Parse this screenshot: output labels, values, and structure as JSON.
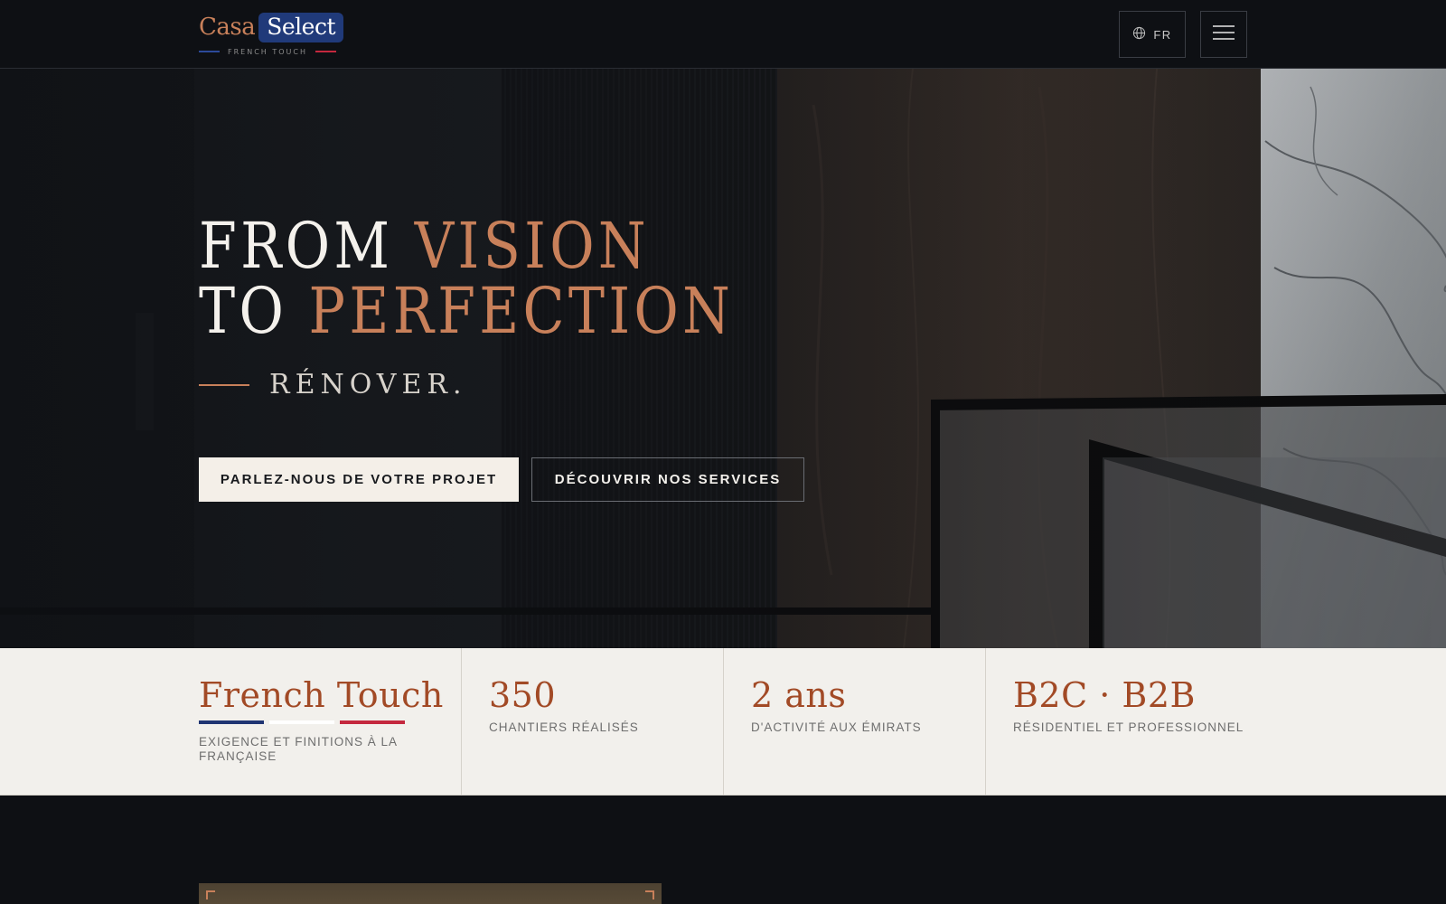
{
  "header": {
    "logo": {
      "part1": "Casa",
      "part2": "Select",
      "tagline": "FRENCH TOUCH"
    },
    "lang_label": "FR",
    "icons": {
      "lang": "globe-icon",
      "menu": "hamburger-menu-icon"
    }
  },
  "hero": {
    "title_line1_plain": "FROM ",
    "title_line1_accent": "VISION",
    "title_line2_plain": "TO ",
    "title_line2_accent": "PERFECTION",
    "subtitle": "RÉNOVER.",
    "cta_primary": "PARLEZ-NOUS DE VOTRE PROJET",
    "cta_secondary": "DÉCOUVRIR NOS SERVICES"
  },
  "stats": [
    {
      "value": "French Touch",
      "label": "EXIGENCE ET FINITIONS À LA FRANÇAISE"
    },
    {
      "value": "350",
      "label": "CHANTIERS RÉALISÉS"
    },
    {
      "value": "2 ans",
      "label": "D'ACTIVITÉ AUX ÉMIRATS"
    },
    {
      "value": "B2C · B2B",
      "label": "RÉSIDENTIEL ET PROFESSIONNEL"
    }
  ],
  "colors": {
    "accent": "#c8805a",
    "stat_value": "#a24a26",
    "brand_blue": "#203a7a",
    "flag_blue": "#1f3472",
    "flag_white": "#ffffff",
    "flag_red": "#c4283e",
    "dark_bg": "#0e1014"
  }
}
